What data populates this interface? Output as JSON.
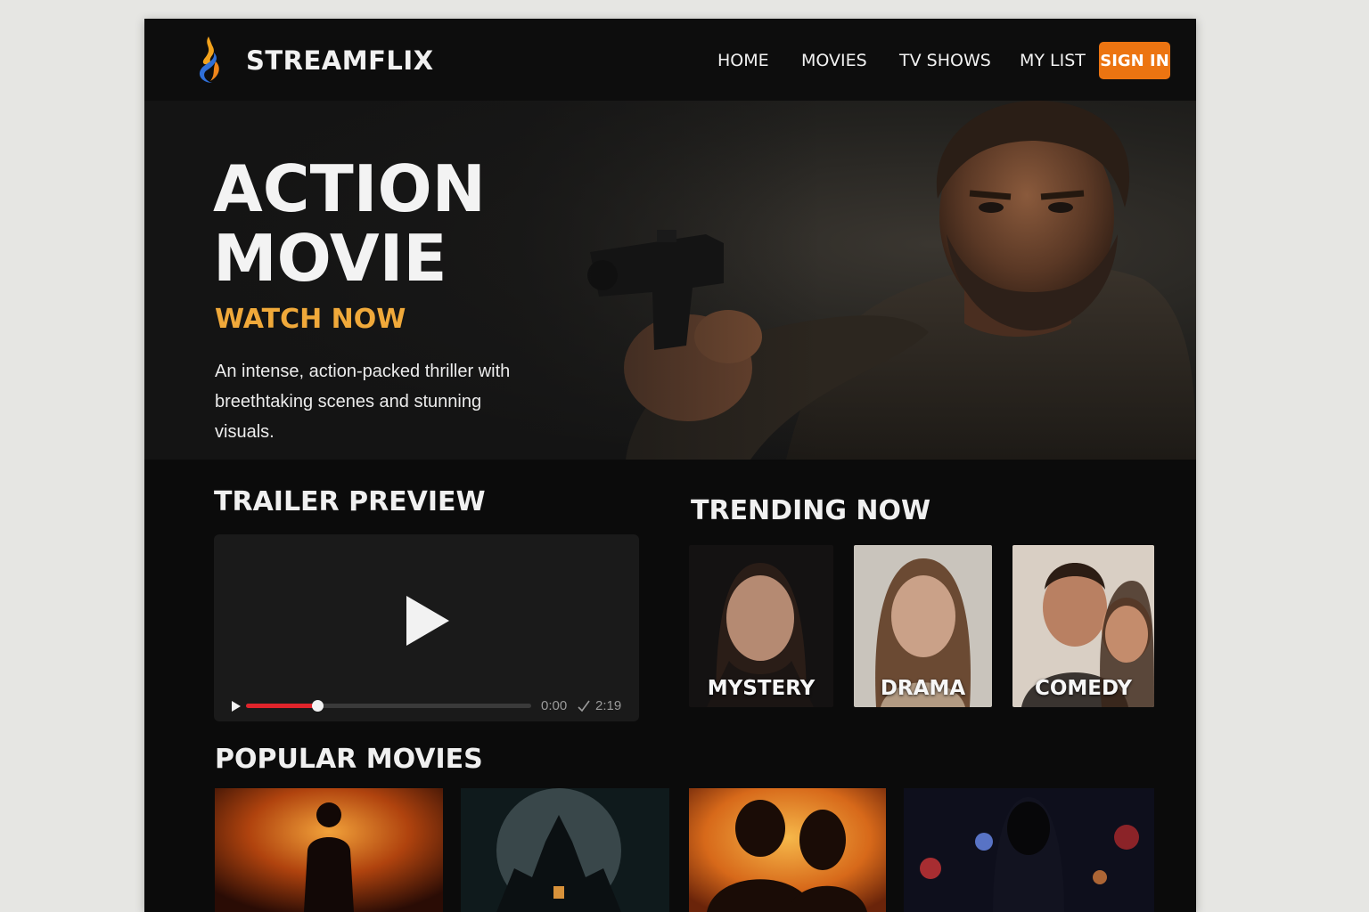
{
  "nav": {
    "brand": "STREAMFLIX",
    "links": [
      "HOME",
      "MOVIES",
      "TV SHOWS",
      "MY LIST"
    ],
    "sign_in": "SIGN IN"
  },
  "hero": {
    "title_line1": "ACTION",
    "title_line2": "MOVIE",
    "cta": "WATCH NOW",
    "description": "An intense, action-packed thriller with breethtaking scenes and stunning visuals."
  },
  "trailer": {
    "heading": "TRAILER PREVIEW",
    "current_time": "0:00",
    "duration": "2:19",
    "progress": 0.25
  },
  "trending": {
    "heading": "TRENDING NOW",
    "items": [
      {
        "label": "MYSTERY"
      },
      {
        "label": "DRAMA"
      },
      {
        "label": "COMEDY"
      }
    ]
  },
  "popular": {
    "heading": "POPULAR MOVIES"
  },
  "colors": {
    "accent": "#ec7411",
    "cta": "#f0a93a",
    "progress": "#e0242b",
    "background": "#0b0b0b"
  },
  "icons": [
    "flame-logo-icon",
    "play-icon",
    "small-play-icon",
    "check-icon"
  ]
}
